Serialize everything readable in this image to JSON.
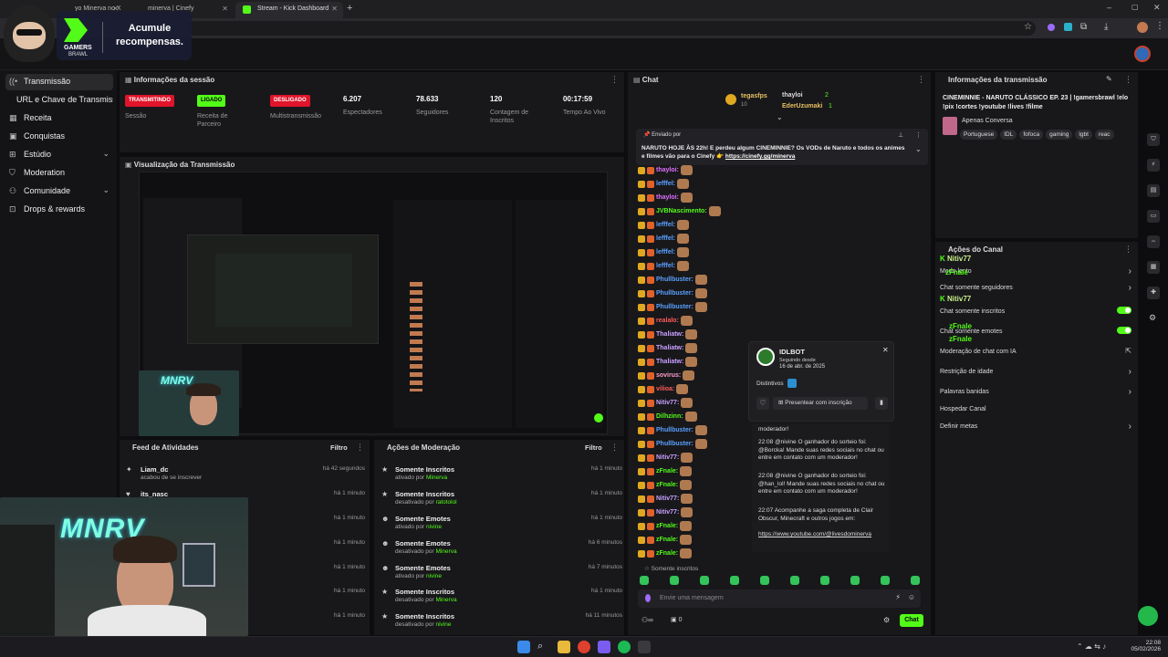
{
  "browser": {
    "tabs": [
      {
        "label": "yo Minerva no X"
      },
      {
        "label": "minerva | Cinefy"
      },
      {
        "label": "Stream - Kick Dashboard"
      }
    ]
  },
  "overlay": {
    "brand_line1": "GAMERS",
    "brand_line2": "BRAWL",
    "promo": "Acumule recompensas."
  },
  "sidebar": {
    "items": [
      {
        "label": "Transmissão"
      },
      {
        "label": "URL e Chave de Transmissão"
      },
      {
        "label": "Receita"
      },
      {
        "label": "Conquistas"
      },
      {
        "label": "Estúdio"
      },
      {
        "label": "Moderation"
      },
      {
        "label": "Comunidade"
      },
      {
        "label": "Drops & rewards"
      }
    ]
  },
  "session": {
    "title": "Informações da sessão",
    "stats": [
      {
        "badge": "TRANSMITINDO",
        "label": "Sessão"
      },
      {
        "badge": "LIGADO",
        "label": "Receita de Parceiro"
      },
      {
        "badge": "DESLIGADO",
        "label": "Multistransmissão"
      },
      {
        "value": "6.207",
        "label": "Espectadores"
      },
      {
        "value": "78.633",
        "label": "Seguidores"
      },
      {
        "value": "120",
        "label": "Contagem de Inscritos"
      },
      {
        "value": "00:17:59",
        "label": "Tempo Ao Vivo"
      }
    ]
  },
  "preview": {
    "title": "Visualização da Transmissão"
  },
  "feed": {
    "title": "Feed de Atividades",
    "filter": "Filtro",
    "rows": [
      {
        "name": "Liam_dc",
        "desc": "acabou de se inscrever",
        "time": "há 42 segundos"
      },
      {
        "name": "its_nasc",
        "desc": "",
        "time": "há 1 minuto"
      },
      {
        "name": "",
        "desc": "",
        "time": "há 1 minuto"
      },
      {
        "name": "",
        "desc": "",
        "time": "há 1 minuto"
      },
      {
        "name": "",
        "desc": "",
        "time": "há 1 minuto"
      },
      {
        "name": "",
        "desc": "",
        "time": "há 1 minuto"
      },
      {
        "name": "",
        "desc": "",
        "time": "há 1 minuto"
      }
    ]
  },
  "moderation": {
    "title": "Ações de Moderação",
    "filter": "Filtro",
    "rows": [
      {
        "name": "Somente Inscritos",
        "pre": "ativado por",
        "by": "Minerva",
        "time": "há 1 minuto"
      },
      {
        "name": "Somente Inscritos",
        "pre": "desativado por",
        "by": "ratotolol",
        "time": "há 1 minuto"
      },
      {
        "name": "Somente Emotes",
        "pre": "ativado por",
        "by": "nivine",
        "time": "há 1 minuto"
      },
      {
        "name": "Somente Emotes",
        "pre": "desativado por",
        "by": "Minerva",
        "time": "há 6 minutos"
      },
      {
        "name": "Somente Emotes",
        "pre": "ativado por",
        "by": "nivine",
        "time": "há 7 minutos"
      },
      {
        "name": "Somente Inscritos",
        "pre": "desativado por",
        "by": "Minerva",
        "time": "há 1 minuto"
      },
      {
        "name": "Somente Inscritos",
        "pre": "desativado por",
        "by": "nivine",
        "time": "há 11 minutos"
      }
    ]
  },
  "chat": {
    "title": "Chat",
    "leaders": [
      {
        "name": "tegasfps",
        "count": "10"
      },
      {
        "name": "thayloi",
        "count": "2"
      },
      {
        "name": "EderUzumaki",
        "count": "1"
      }
    ],
    "pinned": {
      "sent_by": "Enviado por",
      "message": "NARUTO HOJE ÀS 22h! E perdeu algum CINEMINNIE? Os VODs de Naruto e todos os animes e filmes vão para o Cinefy 👉",
      "link": "https://cinefy.gg/minerva"
    },
    "messages": [
      {
        "user": "thayloi:",
        "color": "#e06fff"
      },
      {
        "user": "lefffel:",
        "color": "#5aa0ff"
      },
      {
        "user": "thayloi:",
        "color": "#e06fff"
      },
      {
        "user": "JVBNascimento:",
        "color": "#53fc18"
      },
      {
        "user": "lefffel:",
        "color": "#5aa0ff"
      },
      {
        "user": "lefffel:",
        "color": "#5aa0ff"
      },
      {
        "user": "lefffel:",
        "color": "#5aa0ff"
      },
      {
        "user": "lefffel:",
        "color": "#5aa0ff"
      },
      {
        "user": "Phullbuster:",
        "color": "#5aa0ff"
      },
      {
        "user": "Phullbuster:",
        "color": "#5aa0ff"
      },
      {
        "user": "Phullbuster:",
        "color": "#5aa0ff"
      },
      {
        "user": "realalo:",
        "color": "#ff5a5a"
      },
      {
        "user": "Thaliatw:",
        "color": "#c9a0ff"
      },
      {
        "user": "Thaliatw:",
        "color": "#c9a0ff"
      },
      {
        "user": "Thaliatw:",
        "color": "#c9a0ff"
      },
      {
        "user": "sovirus:",
        "color": "#ff9cc8"
      },
      {
        "user": "vilioa:",
        "color": "#ff5a5a"
      },
      {
        "user": "Nitiv77:",
        "color": "#c9a0ff"
      },
      {
        "user": "Dilhzinn:",
        "color": "#53fc18"
      },
      {
        "user": "Phullbuster:",
        "color": "#5aa0ff"
      },
      {
        "user": "Phullbuster:",
        "color": "#5aa0ff"
      },
      {
        "user": "Nitiv77:",
        "color": "#c9a0ff"
      },
      {
        "user": "zFnale:",
        "color": "#53fc18"
      },
      {
        "user": "zFnale:",
        "color": "#53fc18"
      },
      {
        "user": "Nitiv77:",
        "color": "#c9a0ff"
      },
      {
        "user": "Nitiv77:",
        "color": "#c9a0ff"
      },
      {
        "user": "zFnale:",
        "color": "#53fc18"
      },
      {
        "user": "zFnale:",
        "color": "#53fc18"
      },
      {
        "user": "zFnale:",
        "color": "#53fc18"
      }
    ],
    "mode_note": "Somente inscritos",
    "input_placeholder": "Envie uma mensagem",
    "viewers": "0",
    "send": "Chat"
  },
  "usercard": {
    "name": "IDLBOT",
    "following_label": "Seguindo desde",
    "following_date": "16 de abr. de 2025",
    "badges_label": "Distintivos",
    "gift_button": "Presentear com inscrição",
    "messages": [
      {
        "text": "moderador!"
      },
      {
        "text": "22:08 @nivine O ganhador do sorteio foi: @Borcka! Mande suas redes sociais no chat ou entre em contato com um moderador!"
      },
      {
        "text": "22:08 @nivine O ganhador do sorteio foi: @han_lol! Mande suas redes sociais no chat ou entre em contato com um moderador!"
      },
      {
        "text": "22:07 Acompanhe a saga completa de Clair Obscur, Minecraft e outros jogos em:"
      }
    ],
    "link": "https://www.youtube.com/@livesdominerva"
  },
  "stream_info": {
    "title": "Informações da transmissão",
    "stream_title": "CINEMINNIE - NARUTO CLÁSSICO EP. 23 | !gamersbrawl !elo !pix !cortes !youtube !lives !filme",
    "category": "Apenas Conversa",
    "tags": [
      "Portuguese",
      "IDL",
      "fofoca",
      "gaming",
      "lgbt",
      "reac"
    ]
  },
  "channel_actions": {
    "title": "Ações do Canal",
    "overlay_users": [
      "Nitiv77",
      "zFnale",
      "Nitiv77",
      "zFnale",
      "zFnale"
    ],
    "items": [
      {
        "label": "Modo lento",
        "control": "chevron"
      },
      {
        "label": "Chat somente seguidores",
        "control": "chevron"
      },
      {
        "label": "Chat somente inscritos",
        "control": "toggle"
      },
      {
        "label": "Chat somente emotes",
        "control": "toggle"
      },
      {
        "label": "Moderação de chat com IA",
        "control": "external"
      },
      {
        "label": "Restrição de idade",
        "control": "chevron"
      },
      {
        "label": "Palavras banidas",
        "control": "chevron"
      },
      {
        "label": "Hospedar Canal",
        "control": "none"
      },
      {
        "label": "Definir metas",
        "control": "chevron"
      }
    ]
  },
  "taskbar": {
    "time": "22:08",
    "date": "05/02/2026"
  },
  "colors": {
    "brand": "#53fc18",
    "live_red": "#e0142a",
    "bg": "#0d0d0f",
    "panel": "#18181b"
  }
}
